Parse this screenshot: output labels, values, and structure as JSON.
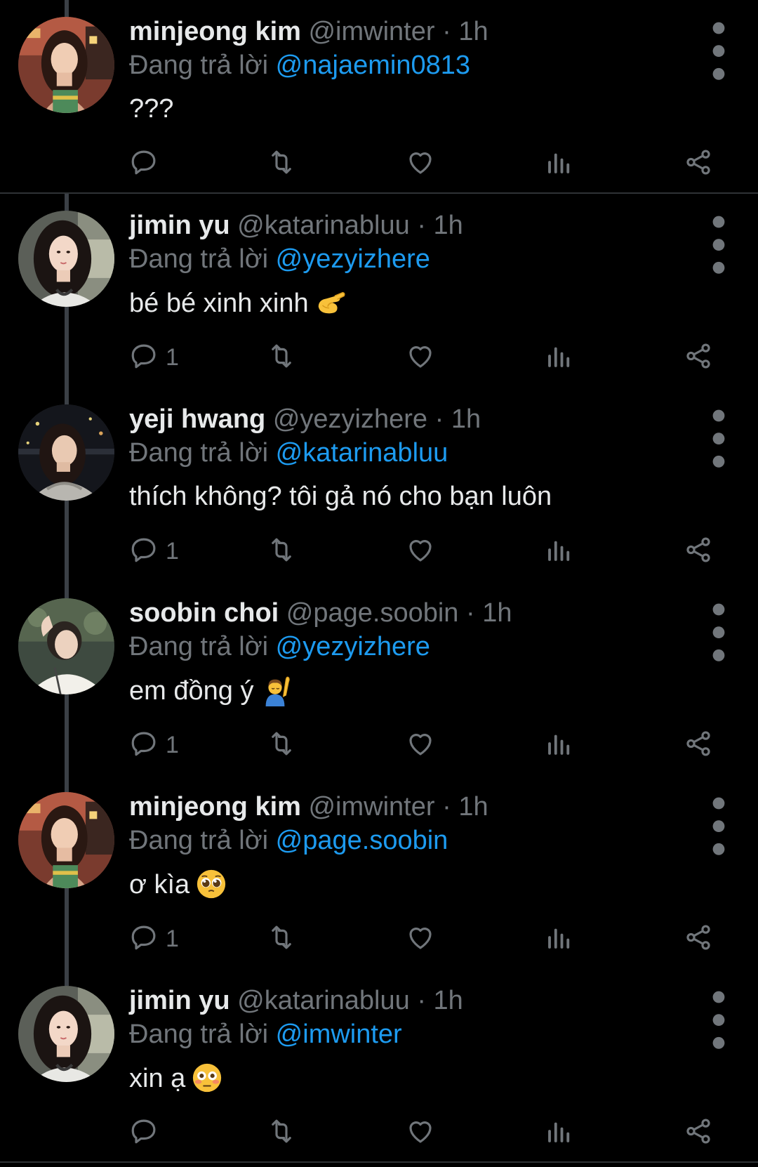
{
  "colors": {
    "background": "#000000",
    "text": "#e7e9ea",
    "muted": "#71767b",
    "mention": "#1d9bf0",
    "thread_line": "#3b4046"
  },
  "tweets": [
    {
      "name": "minjeong kim",
      "handle": "@imwinter",
      "dot": "·",
      "time": "1h",
      "reply_prefix": "Đang trả lời",
      "reply_to": "@najaemin0813",
      "text": "???",
      "emoji": "",
      "reply_count": "",
      "avatar": "avatar-minjeong"
    },
    {
      "name": "jimin yu",
      "handle": "@katarinabluu",
      "dot": "·",
      "time": "1h",
      "reply_prefix": "Đang trả lời",
      "reply_to": "@yezyizhere",
      "text": "bé bé xinh xinh",
      "emoji": "pinching-hand-emoji",
      "reply_count": "1",
      "avatar": "avatar-jimin"
    },
    {
      "name": "yeji hwang",
      "handle": "@yezyizhere",
      "dot": "·",
      "time": "1h",
      "reply_prefix": "Đang trả lời",
      "reply_to": "@katarinabluu",
      "text": "thích không? tôi gả nó cho bạn luôn",
      "emoji": "",
      "reply_count": "1",
      "avatar": "avatar-yeji"
    },
    {
      "name": "soobin choi",
      "handle": "@page.soobin",
      "dot": "·",
      "time": "1h",
      "reply_prefix": "Đang trả lời",
      "reply_to": "@yezyizhere",
      "text": "em đồng ý",
      "emoji": "person-raising-hand-emoji",
      "reply_count": "1",
      "avatar": "avatar-soobin"
    },
    {
      "name": "minjeong kim",
      "handle": "@imwinter",
      "dot": "·",
      "time": "1h",
      "reply_prefix": "Đang trả lời",
      "reply_to": "@page.soobin",
      "text": "ơ kìa",
      "emoji": "pleading-face-emoji",
      "reply_count": "1",
      "avatar": "avatar-minjeong"
    },
    {
      "name": "jimin yu",
      "handle": "@katarinabluu",
      "dot": "·",
      "time": "1h",
      "reply_prefix": "Đang trả lời",
      "reply_to": "@imwinter",
      "text": "xin ạ",
      "emoji": "flushed-face-emoji",
      "reply_count": "",
      "avatar": "avatar-jimin"
    }
  ],
  "icons": {
    "reply": "reply-icon",
    "retweet": "retweet-icon",
    "like": "heart-icon",
    "views": "views-icon",
    "share": "share-icon",
    "more": "more-vertical-icon"
  }
}
